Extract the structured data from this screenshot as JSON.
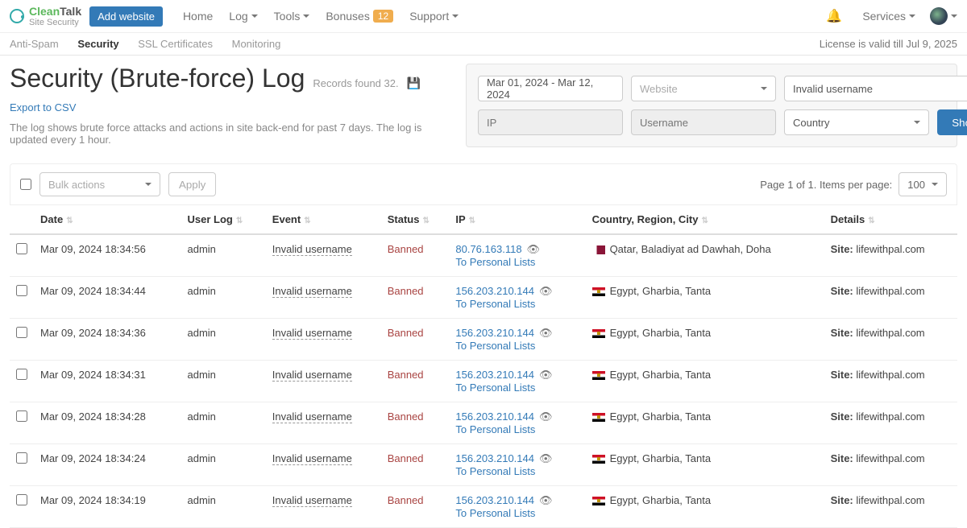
{
  "nav": {
    "brand_clean": "Clean",
    "brand_talk": "Talk",
    "brand_sub": "Site Security",
    "add_website": "Add website",
    "home": "Home",
    "log": "Log",
    "tools": "Tools",
    "bonuses": "Bonuses",
    "bonuses_badge": "12",
    "support": "Support",
    "services": "Services"
  },
  "subnav": {
    "antispam": "Anti-Spam",
    "security": "Security",
    "ssl": "SSL Certificates",
    "monitoring": "Monitoring",
    "license": "License is valid till Jul 9, 2025"
  },
  "header": {
    "title": "Security (Brute-force) Log",
    "records": "Records found 32.",
    "export": "Export to CSV",
    "desc": "The log shows brute force attacks and actions in site back-end for past 7 days. The log is updated every 1 hour."
  },
  "filters": {
    "daterange": "Mar 01, 2024 - Mar 12, 2024",
    "ip_ph": "IP",
    "username_ph": "Username",
    "website": "Website",
    "event": "Invalid username",
    "country": "Country",
    "show": "Show"
  },
  "toolbar": {
    "bulk": "Bulk actions",
    "apply": "Apply",
    "pager": "Page 1 of 1. Items per page:",
    "perpage": "100"
  },
  "columns": {
    "date": "Date",
    "userlog": "User Log",
    "event": "Event",
    "status": "Status",
    "ip": "IP",
    "country": "Country, Region, City",
    "details": "Details"
  },
  "rows": [
    {
      "date": "Mar 09, 2024 18:34:56",
      "user": "admin",
      "event": "Invalid username",
      "status": "Banned",
      "ip": "80.76.163.118",
      "personal": "To Personal Lists",
      "flag": "qa",
      "loc": "Qatar, Baladiyat ad Dawhah, Doha",
      "site_label": "Site:",
      "site": "lifewithpal.com"
    },
    {
      "date": "Mar 09, 2024 18:34:44",
      "user": "admin",
      "event": "Invalid username",
      "status": "Banned",
      "ip": "156.203.210.144",
      "personal": "To Personal Lists",
      "flag": "eg",
      "loc": "Egypt, Gharbia, Tanta",
      "site_label": "Site:",
      "site": "lifewithpal.com"
    },
    {
      "date": "Mar 09, 2024 18:34:36",
      "user": "admin",
      "event": "Invalid username",
      "status": "Banned",
      "ip": "156.203.210.144",
      "personal": "To Personal Lists",
      "flag": "eg",
      "loc": "Egypt, Gharbia, Tanta",
      "site_label": "Site:",
      "site": "lifewithpal.com"
    },
    {
      "date": "Mar 09, 2024 18:34:31",
      "user": "admin",
      "event": "Invalid username",
      "status": "Banned",
      "ip": "156.203.210.144",
      "personal": "To Personal Lists",
      "flag": "eg",
      "loc": "Egypt, Gharbia, Tanta",
      "site_label": "Site:",
      "site": "lifewithpal.com"
    },
    {
      "date": "Mar 09, 2024 18:34:28",
      "user": "admin",
      "event": "Invalid username",
      "status": "Banned",
      "ip": "156.203.210.144",
      "personal": "To Personal Lists",
      "flag": "eg",
      "loc": "Egypt, Gharbia, Tanta",
      "site_label": "Site:",
      "site": "lifewithpal.com"
    },
    {
      "date": "Mar 09, 2024 18:34:24",
      "user": "admin",
      "event": "Invalid username",
      "status": "Banned",
      "ip": "156.203.210.144",
      "personal": "To Personal Lists",
      "flag": "eg",
      "loc": "Egypt, Gharbia, Tanta",
      "site_label": "Site:",
      "site": "lifewithpal.com"
    },
    {
      "date": "Mar 09, 2024 18:34:19",
      "user": "admin",
      "event": "Invalid username",
      "status": "Banned",
      "ip": "156.203.210.144",
      "personal": "To Personal Lists",
      "flag": "eg",
      "loc": "Egypt, Gharbia, Tanta",
      "site_label": "Site:",
      "site": "lifewithpal.com"
    }
  ]
}
